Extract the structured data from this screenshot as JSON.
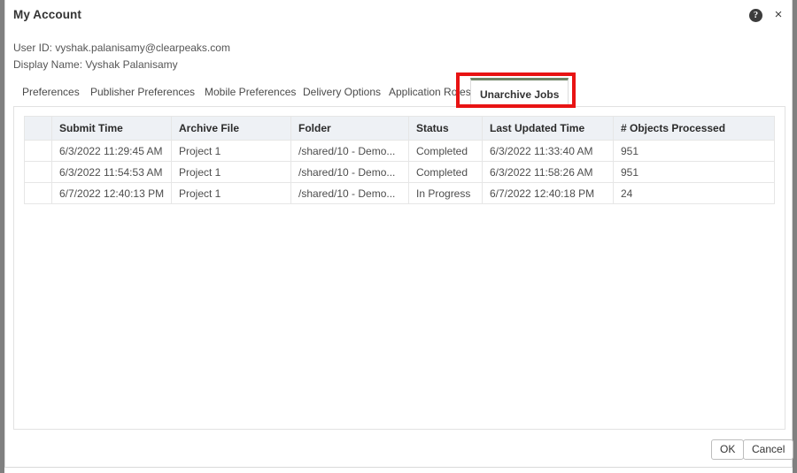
{
  "window": {
    "title": "My Account",
    "help_icon": "help-icon",
    "help_glyph": "?",
    "close_icon": "close-icon",
    "close_glyph": "×"
  },
  "identity": {
    "user_id": "User ID: vyshak.palanisamy@clearpeaks.com",
    "display_name": "Display Name: Vyshak Palanisamy"
  },
  "tabs": [
    {
      "label": "Preferences",
      "active": false
    },
    {
      "label": "Publisher Preferences",
      "active": false
    },
    {
      "label": "Mobile Preferences",
      "active": false
    },
    {
      "label": "Delivery Options",
      "active": false
    },
    {
      "label": "Application Roles",
      "active": false
    },
    {
      "label": "Unarchive Jobs",
      "active": true
    }
  ],
  "annotation": {
    "shape": "rectangle",
    "color": "#e81313",
    "target": "Unarchive Jobs"
  },
  "colors": {
    "active_tab_accent": "#6f8466",
    "annotation_red": "#e81313",
    "grid_header_bg": "#eef1f5",
    "window_edge": "#808080"
  },
  "grid": {
    "columns": [
      "",
      "Submit Time",
      "Archive File",
      "Folder",
      "Status",
      "Last Updated Time",
      "# Objects Processed"
    ],
    "rows": [
      {
        "select": "",
        "submit_time": "6/3/2022 11:29:45 AM",
        "archive_file": "Project 1",
        "folder": "/shared/10 - Demo...",
        "status": "Completed",
        "last_updated_time": "6/3/2022 11:33:40 AM",
        "objects_processed": "951"
      },
      {
        "select": "",
        "submit_time": "6/3/2022 11:54:53 AM",
        "archive_file": "Project 1",
        "folder": "/shared/10 - Demo...",
        "status": "Completed",
        "last_updated_time": "6/3/2022 11:58:26 AM",
        "objects_processed": "951"
      },
      {
        "select": "",
        "submit_time": "6/7/2022 12:40:13 PM",
        "archive_file": "Project 1",
        "folder": "/shared/10 - Demo...",
        "status": "In Progress",
        "last_updated_time": "6/7/2022 12:40:18 PM",
        "objects_processed": "24"
      }
    ]
  },
  "footer": {
    "ok_label": "OK",
    "cancel_label": "Cancel"
  }
}
